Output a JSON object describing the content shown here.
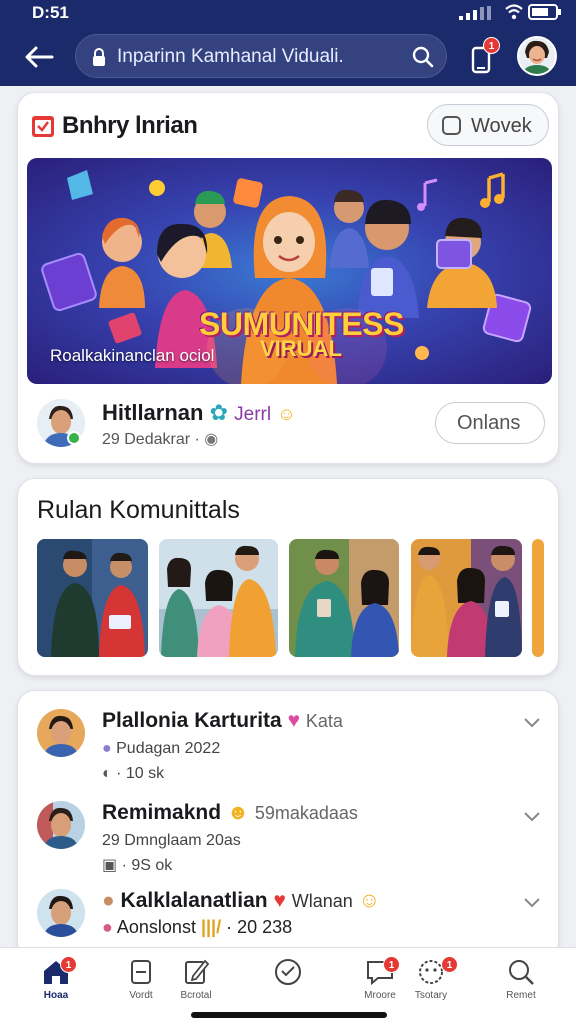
{
  "status_bar": {
    "time": "D:51"
  },
  "header": {
    "search_text": "Inparinn Kamhanal Viduali.",
    "notification_badge": "1"
  },
  "event_card": {
    "title": "Bnhry lnrian",
    "action_button": "Wovek",
    "banner": {
      "headline": "SUMUNITESS",
      "subheadline": "VIRUAL",
      "caption": "Roalkakinanclan ociol"
    },
    "host": {
      "name": "Hitllarnan",
      "tag": "Jerrl",
      "meta": "29 Dedakrar ·"
    },
    "host_button": "Onlans"
  },
  "community_card": {
    "title": "Rulan Komunittals"
  },
  "feed": {
    "posts": [
      {
        "name": "Plallonia Karturita",
        "extra": "Kata",
        "line1": "Pudagan 2022",
        "line2": "· 10 sk"
      },
      {
        "name": "Remimaknd",
        "extra": "59makadaas",
        "line1": "29 Dmnglaam 20as",
        "line2": "· 9S ok"
      },
      {
        "name": "Kalklalanatlian",
        "extra": "Wlanan",
        "line1": "Aonslonst",
        "line2": "· 20 238"
      }
    ]
  },
  "bottom_nav": {
    "items": [
      {
        "label": "Hoaa",
        "icon": "home-icon",
        "badge": "1"
      },
      {
        "label": "Vordt",
        "icon": "calendar-icon",
        "badge": ""
      },
      {
        "label": "Bcrotal",
        "icon": "edit-icon",
        "badge": ""
      },
      {
        "label": "",
        "icon": "chat-bubble-icon",
        "badge": ""
      },
      {
        "label": "Mroore",
        "icon": "message-icon",
        "badge": "1"
      },
      {
        "label": "Tsotary",
        "icon": "community-icon",
        "badge": "1"
      },
      {
        "label": "Remet",
        "icon": "search-icon",
        "badge": ""
      }
    ]
  },
  "colors": {
    "header_bg": "#1b2a6b",
    "badge_red": "#e53935",
    "online_green": "#35b34a"
  }
}
